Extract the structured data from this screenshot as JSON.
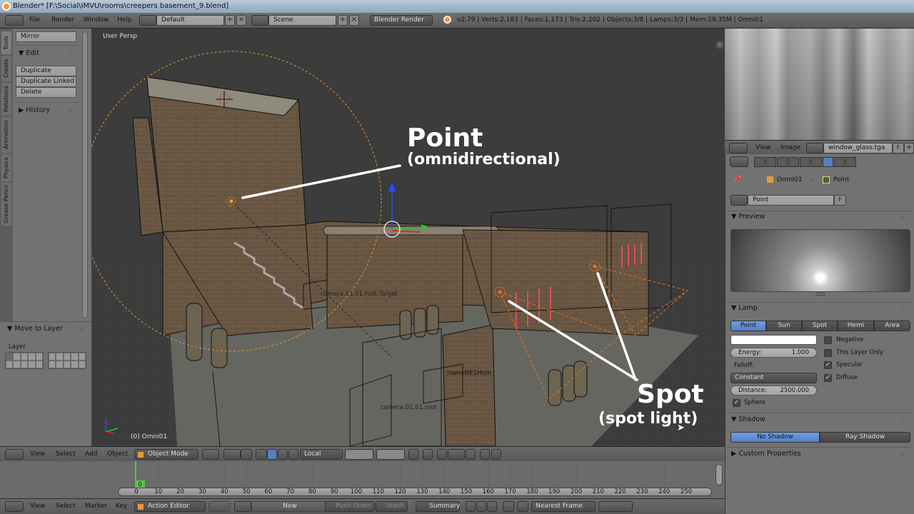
{
  "window": {
    "title": "Blender* [F:\\Social\\IMVU\\rooms\\creepers basement_9.blend]"
  },
  "info_header": {
    "menus": [
      "File",
      "Render",
      "Window",
      "Help"
    ],
    "screen_layout": "Default",
    "scene": "Scene",
    "render_engine": "Blender Render",
    "stats": "v2.79 | Verts:2,183 | Faces:1,173 | Tris:2,202 | Objects:3/8 | Lamps:3/3 | Mem:29.35M | Omni01"
  },
  "tool_shelf": {
    "tabs": [
      "Tools",
      "Create",
      "Relations",
      "Animation",
      "Physics",
      "Grease Pencil"
    ],
    "active_tab": "Tools",
    "mirror_button": "Mirror",
    "edit_panel": {
      "title": "Edit",
      "buttons": [
        "Duplicate",
        "Duplicate Linked",
        "Delete"
      ]
    },
    "history_panel": "History",
    "operator_panel": {
      "title": "Move to Layer",
      "layer_label": "Layer"
    }
  },
  "viewport": {
    "view_name": "User Persp",
    "object_info": "(0) Omni01",
    "labels": {
      "camera_target": "camera.01.01.root.Target",
      "camera_root": "camera.01.01.root",
      "overlap_label": "nameMESHom"
    },
    "annotations": {
      "point_title": "Point",
      "point_sub": "(omnidirectional)",
      "spot_title": "Spot",
      "spot_sub": "(spot light)"
    },
    "colors": {
      "lamp": "#f08a24",
      "background": "#3c3c3c",
      "wall": "#6e5a43"
    }
  },
  "view3d_header": {
    "menus": [
      "View",
      "Select",
      "Add",
      "Object"
    ],
    "mode": "Object Mode",
    "orientation": "Local"
  },
  "timeline": {
    "current_frame": "0",
    "ticks": [
      "0",
      "10",
      "20",
      "30",
      "40",
      "50",
      "60",
      "70",
      "80",
      "90",
      "100",
      "110",
      "120",
      "130",
      "140",
      "150",
      "160",
      "170",
      "180",
      "190",
      "200",
      "210",
      "220",
      "230",
      "240",
      "250"
    ]
  },
  "action_header": {
    "menus": [
      "View",
      "Select",
      "Marker",
      "Key"
    ],
    "editor_mode": "Action Editor",
    "new_button": "New",
    "push_down": "Push Down",
    "stash": "Stash",
    "summary": "Summary",
    "snap_mode": "Nearest Frame"
  },
  "image_editor": {
    "menus": [
      "View",
      "Image"
    ],
    "image_name": "window_glass.tga",
    "fake_user": "F"
  },
  "properties": {
    "breadcrumb": [
      "Omni01",
      "Point"
    ],
    "datablock_name": "Point",
    "fake_user": "F",
    "preview_title": "Preview",
    "lamp_title": "Lamp",
    "lamp_types": [
      "Point",
      "Sun",
      "Spot",
      "Hemi",
      "Area"
    ],
    "active_lamp_type": "Point",
    "color": "#ffffff",
    "energy_label": "Energy:",
    "energy_value": "1.000",
    "falloff_label": "Falloff:",
    "falloff_value": "Constant",
    "distance_label": "Distance:",
    "distance_value": "2500.000",
    "sphere_label": "Sphere",
    "sphere_checked": true,
    "negative_label": "Negative",
    "negative_checked": false,
    "this_layer_only_label": "This Layer Only",
    "this_layer_only_checked": false,
    "specular_label": "Specular",
    "specular_checked": true,
    "diffuse_label": "Diffuse",
    "diffuse_checked": true,
    "shadow_title": "Shadow",
    "shadow_options": [
      "No Shadow",
      "Ray Shadow"
    ],
    "active_shadow": "No Shadow",
    "custom_properties_title": "Custom Properties",
    "accent_color": "#5680c2"
  }
}
